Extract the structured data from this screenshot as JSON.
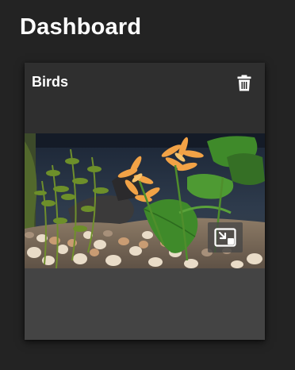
{
  "page": {
    "title": "Dashboard"
  },
  "card": {
    "title": "Birds",
    "delete_icon": "trash-icon",
    "pip_icon": "picture-in-picture-icon"
  },
  "colors": {
    "background": "#232323",
    "card": "#2f2f2f",
    "card_footer": "#444444",
    "text": "#ffffff"
  }
}
